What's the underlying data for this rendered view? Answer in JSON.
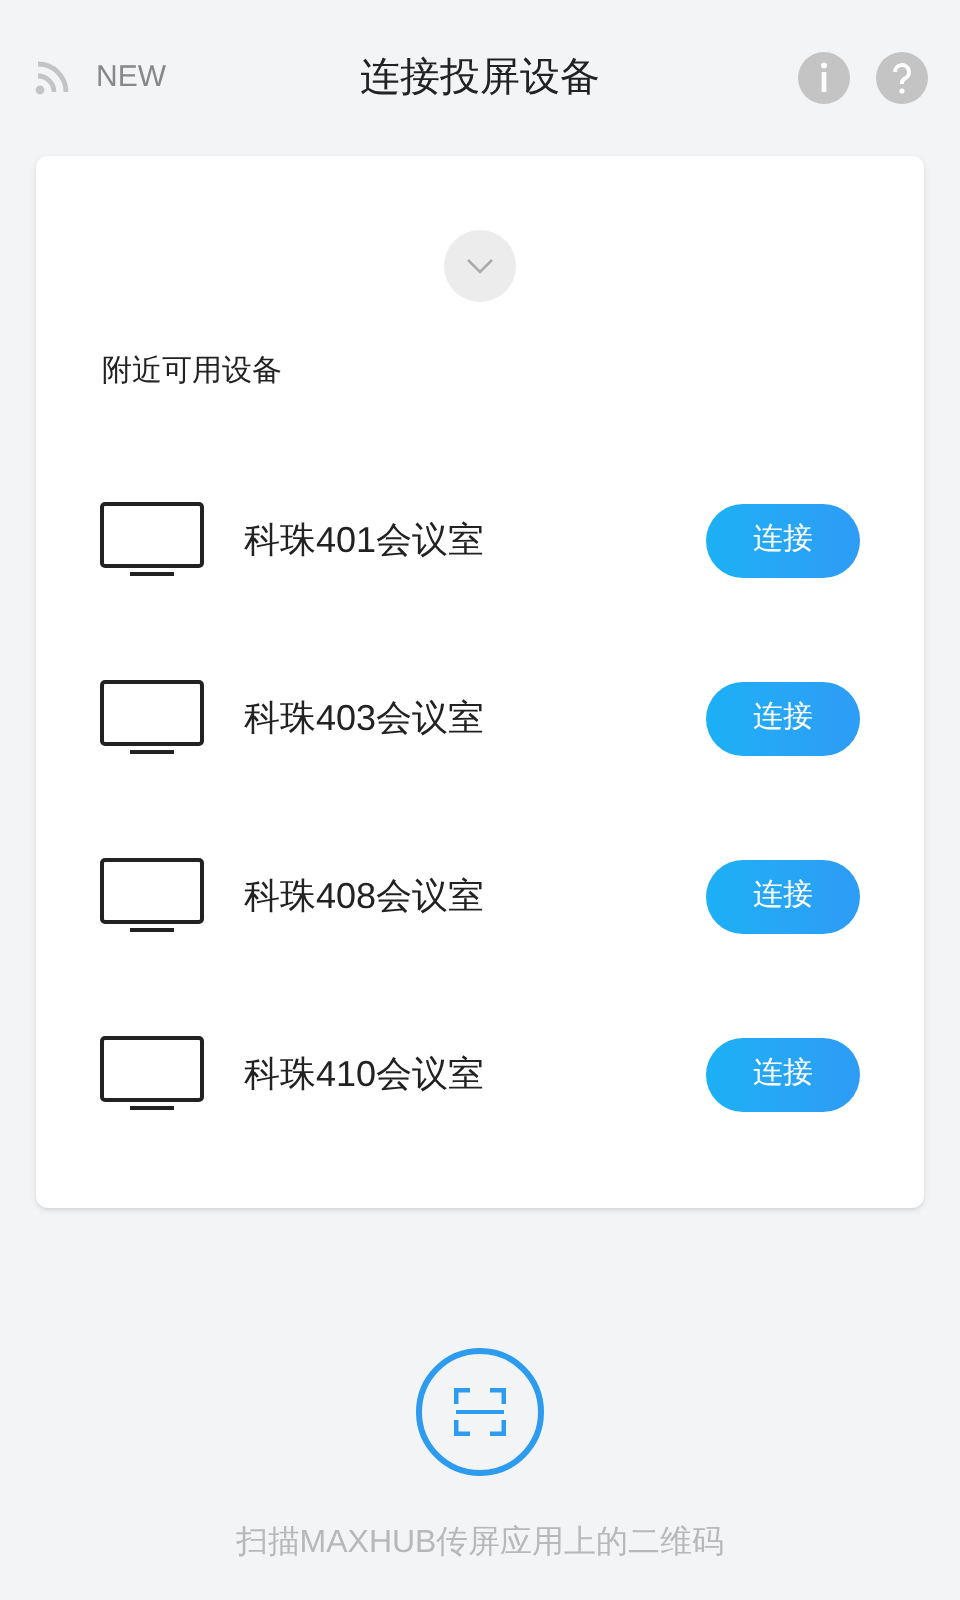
{
  "header": {
    "badge": "NEW",
    "title": "连接投屏设备"
  },
  "card": {
    "section_title": "附近可用设备",
    "devices": [
      {
        "name": "科珠401会议室",
        "action": "连接"
      },
      {
        "name": "科珠403会议室",
        "action": "连接"
      },
      {
        "name": "科珠408会议室",
        "action": "连接"
      },
      {
        "name": "科珠410会议室",
        "action": "连接"
      }
    ]
  },
  "scan": {
    "hint": "扫描MAXHUB传屏应用上的二维码"
  }
}
